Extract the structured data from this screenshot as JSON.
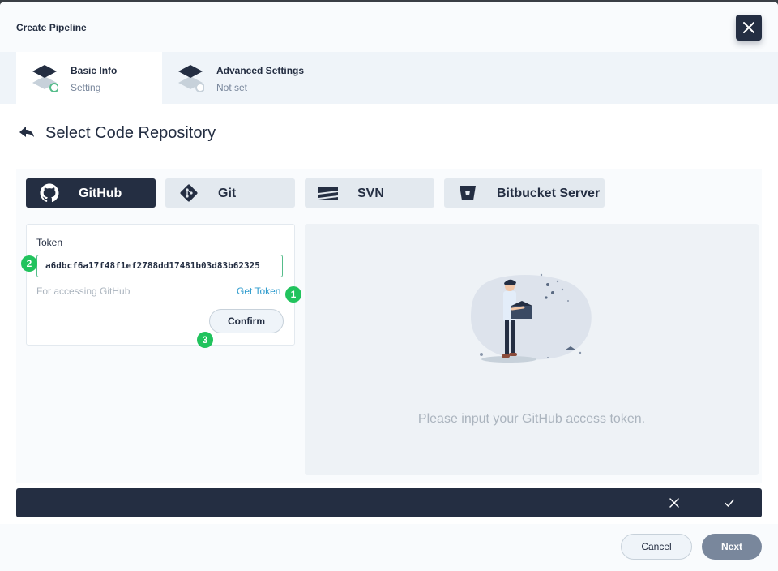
{
  "header": {
    "title": "Create Pipeline"
  },
  "steps": [
    {
      "title": "Basic Info",
      "subtitle": "Setting"
    },
    {
      "title": "Advanced Settings",
      "subtitle": "Not set"
    }
  ],
  "section": {
    "title": "Select Code Repository"
  },
  "repo_tabs": [
    {
      "label": "GitHub",
      "icon": "github-icon",
      "active": true
    },
    {
      "label": "Git",
      "icon": "git-icon",
      "active": false
    },
    {
      "label": "SVN",
      "icon": "svn-icon",
      "active": false
    },
    {
      "label": "Bitbucket Server",
      "icon": "bitbucket-icon",
      "active": false
    }
  ],
  "token_form": {
    "label": "Token",
    "value": "a6dbcf6a17f48f1ef2788dd17481b03d83b62325",
    "hint": "For accessing GitHub",
    "get_token_link": "Get Token",
    "confirm_label": "Confirm"
  },
  "annotations": {
    "badge_1": "1",
    "badge_2": "2",
    "badge_3": "3"
  },
  "empty_state": {
    "message": "Please input your GitHub access token."
  },
  "footer": {
    "cancel_label": "Cancel",
    "next_label": "Next"
  },
  "colors": {
    "primary_dark": "#242e42",
    "accent_green": "#55bc8a",
    "badge_green": "#21c35d",
    "link_blue": "#329dce"
  }
}
